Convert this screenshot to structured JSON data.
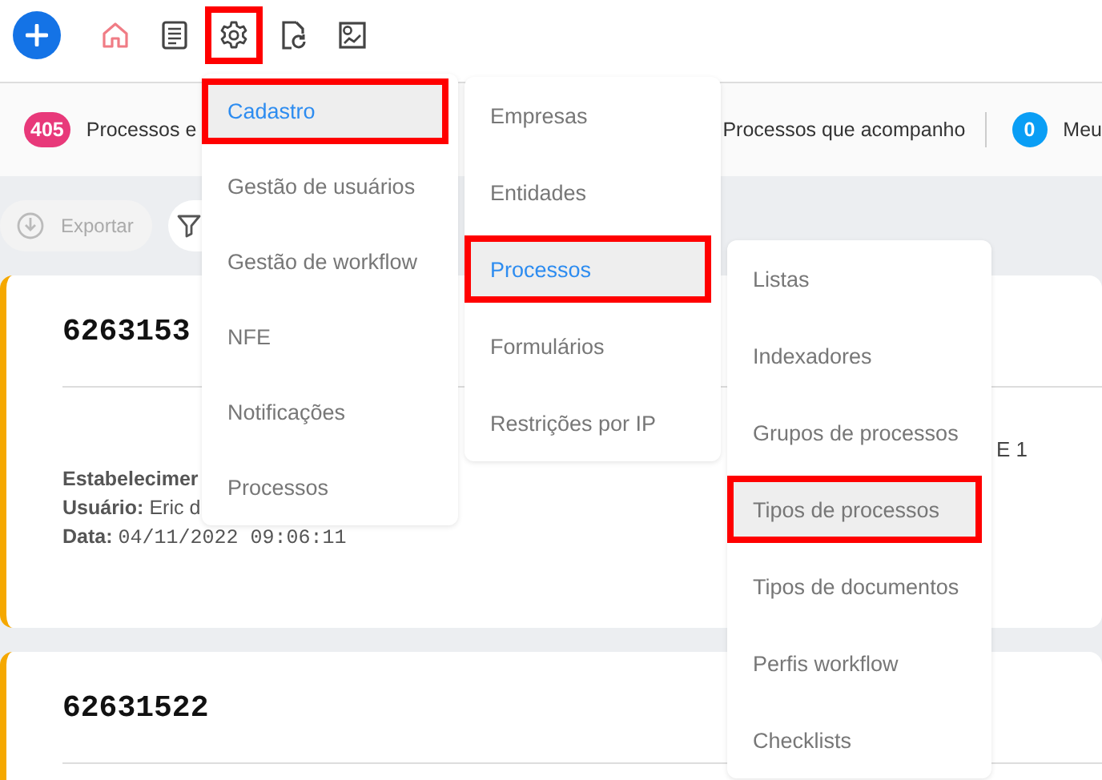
{
  "nav": {
    "icons": [
      {
        "kind": "home",
        "highlighted": false
      },
      {
        "kind": "list",
        "highlighted": false
      },
      {
        "kind": "gear",
        "highlighted": true
      },
      {
        "kind": "refresh",
        "highlighted": false
      },
      {
        "kind": "chart",
        "highlighted": false
      }
    ]
  },
  "stats": [
    {
      "count": "405",
      "label": "Processos e",
      "color": "#e8397a"
    },
    {
      "label": "Processos que acompanho"
    },
    {
      "count": "0",
      "label": "Meu",
      "color": "#0a9ef5"
    }
  ],
  "toolbar": {
    "export_button": "Exportar"
  },
  "cards": [
    {
      "number": "6263153",
      "fields": [
        {
          "label": "Estabelecimer"
        },
        {
          "label": "Usuário:",
          "value": "Eric d"
        },
        {
          "label": "Data:",
          "value": "04/11/2022 09:06:11"
        }
      ],
      "column_3": [
        "E 1"
      ]
    },
    {
      "number": "62631522"
    }
  ],
  "menus": [
    {
      "items": [
        {
          "label": "Cadastro",
          "selected": true,
          "highlighted": true
        },
        {
          "label": "Gestão de usuários",
          "selected": false,
          "highlighted": false
        },
        {
          "label": "Gestão de workflow",
          "selected": false,
          "highlighted": false
        },
        {
          "label": "NFE",
          "selected": false,
          "highlighted": false
        },
        {
          "label": "Notificações",
          "selected": false,
          "highlighted": false
        },
        {
          "label": "Processos",
          "selected": false,
          "highlighted": false
        }
      ]
    },
    {
      "items": [
        {
          "label": "Empresas",
          "selected": false,
          "highlighted": false
        },
        {
          "label": "Entidades",
          "selected": false,
          "highlighted": false
        },
        {
          "label": "Processos",
          "selected": true,
          "highlighted": true
        },
        {
          "label": "Formulários",
          "selected": false,
          "highlighted": false
        },
        {
          "label": "Restrições por IP",
          "selected": false,
          "highlighted": false
        }
      ]
    },
    {
      "items": [
        {
          "label": "Listas",
          "selected": false,
          "highlighted": false
        },
        {
          "label": "Indexadores",
          "selected": false,
          "highlighted": false
        },
        {
          "label": "Grupos de processos",
          "selected": false,
          "highlighted": false
        },
        {
          "label": "Tipos de processos",
          "selected": false,
          "highlighted": true
        },
        {
          "label": "Tipos de documentos",
          "selected": false,
          "highlighted": false
        },
        {
          "label": "Perfis workflow",
          "selected": false,
          "highlighted": false
        },
        {
          "label": "Checklists",
          "selected": false,
          "highlighted": false
        }
      ]
    }
  ]
}
